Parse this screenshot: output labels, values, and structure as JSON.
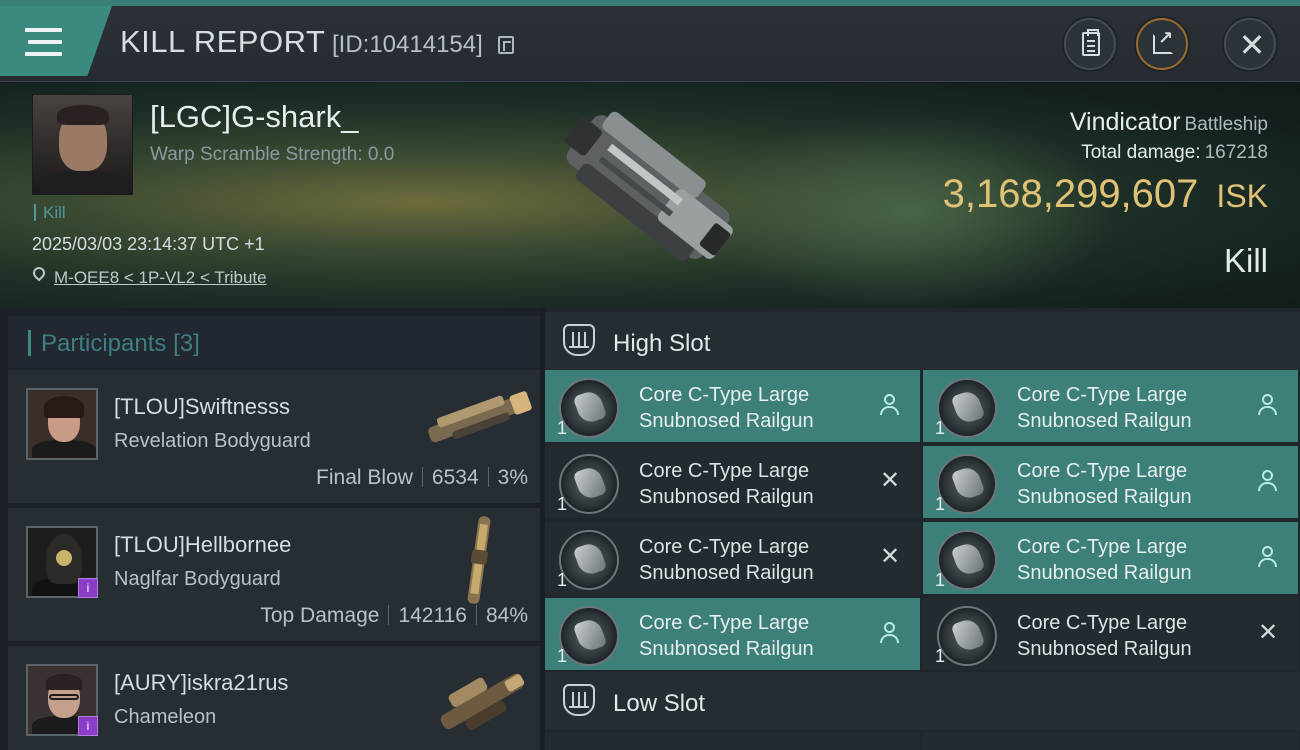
{
  "header": {
    "title": "KILL REPORT",
    "report_id": "[ID:10414154]"
  },
  "victim": {
    "name": "[LGC]G-shark_",
    "warp_scramble": "Warp Scramble Strength: 0.0",
    "tag": "Kill",
    "timestamp": "2025/03/03 23:14:37 UTC +1",
    "location": "M-OEE8 < 1P-VL2 < Tribute",
    "ship_name": "Vindicator",
    "ship_class": "Battleship",
    "total_damage_label": "Total damage:",
    "total_damage": "167218",
    "isk_value": "3,168,299,607",
    "isk_unit": "ISK",
    "result": "Kill"
  },
  "participants": {
    "label": "Participants",
    "count": "[3]",
    "list": [
      {
        "name": "[TLOU]Swiftnesss",
        "ship": "Revelation Bodyguard",
        "stat_label": "Final Blow",
        "damage": "6534",
        "percent": "3%"
      },
      {
        "name": "[TLOU]Hellbornee",
        "ship": "Naglfar Bodyguard",
        "stat_label": "Top Damage",
        "damage": "142116",
        "percent": "84%"
      },
      {
        "name": "[AURY]iskra21rus",
        "ship": "Chameleon"
      }
    ]
  },
  "slots": {
    "high_label": "High Slot",
    "low_label": "Low Slot",
    "high_items": [
      {
        "line1": "Core C-Type Large",
        "line2": "Snubnosed Railgun",
        "qty": "1",
        "state": "dropped"
      },
      {
        "line1": "Core C-Type Large",
        "line2": "Snubnosed Railgun",
        "qty": "1",
        "state": "dropped"
      },
      {
        "line1": "Core C-Type Large",
        "line2": "Snubnosed Railgun",
        "qty": "1",
        "state": "destroyed"
      },
      {
        "line1": "Core C-Type Large",
        "line2": "Snubnosed Railgun",
        "qty": "1",
        "state": "dropped"
      },
      {
        "line1": "Core C-Type Large",
        "line2": "Snubnosed Railgun",
        "qty": "1",
        "state": "destroyed"
      },
      {
        "line1": "Core C-Type Large",
        "line2": "Snubnosed Railgun",
        "qty": "1",
        "state": "dropped"
      },
      {
        "line1": "Core C-Type Large",
        "line2": "Snubnosed Railgun",
        "qty": "1",
        "state": "dropped"
      },
      {
        "line1": "Core C-Type Large",
        "line2": "Snubnosed Railgun",
        "qty": "1",
        "state": "destroyed"
      }
    ]
  },
  "icons": {
    "menu": "menu-icon",
    "copy": "copy-icon",
    "clipboard": "clipboard-icon",
    "share": "share-icon",
    "close": "close-icon",
    "location": "location-pin-icon",
    "slot": "slot-shield-icon",
    "dropped": "person-icon",
    "destroyed": "cross-icon"
  },
  "colors": {
    "accent": "#3d7f79",
    "isk": "#e0c277",
    "header_teal": "#3a8a80",
    "badge_purple": "#8a3ec7"
  }
}
